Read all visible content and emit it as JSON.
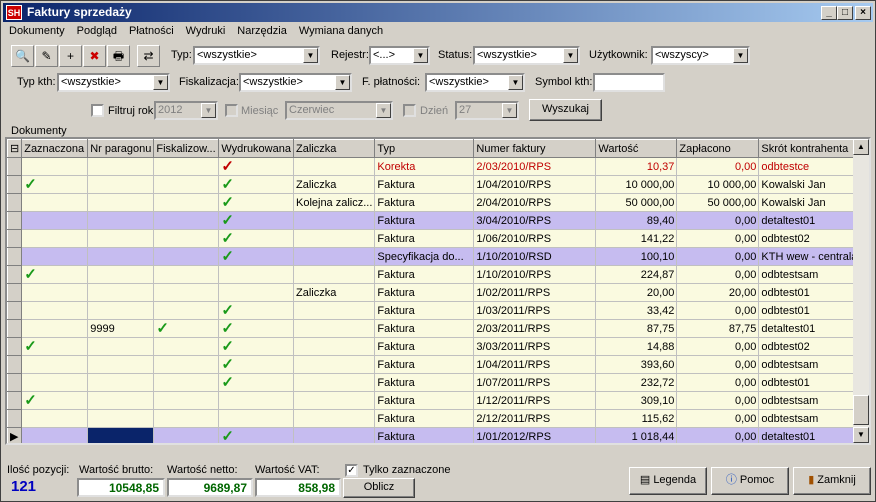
{
  "window": {
    "title": "Faktury sprzedaży",
    "app_badge": "SH"
  },
  "menu": [
    "Dokumenty",
    "Podgląd",
    "Płatności",
    "Wydruki",
    "Narzędzia",
    "Wymiana danych"
  ],
  "filters": {
    "typ_label": "Typ:",
    "typ_value": "<wszystkie>",
    "rejestr_label": "Rejestr:",
    "rejestr_value": "<...>",
    "status_label": "Status:",
    "status_value": "<wszystkie>",
    "uzytkownik_label": "Użytkownik:",
    "uzytkownik_value": "<wszyscy>",
    "typ_kth_label": "Typ kth:",
    "typ_kth_value": "<wszystkie>",
    "fiskalizacja_label": "Fiskalizacja:",
    "fiskalizacja_value": "<wszystkie>",
    "f_platnosci_label": "F. płatności:",
    "f_platnosci_value": "<wszystkie>",
    "symbol_kth_label": "Symbol kth:",
    "symbol_kth_value": "",
    "filtruj_rok_label": "Filtruj rok",
    "rok_value": "2012",
    "miesiac_label": "Miesiąc",
    "miesiac_value": "Czerwiec",
    "dzien_label": "Dzień",
    "dzien_value": "27",
    "search_button": "Wyszukaj"
  },
  "grid": {
    "group_label": "Dokumenty",
    "columns": [
      "Zaznaczona",
      "Nr paragonu",
      "Fiskalizow...",
      "Wydrukowana",
      "Zaliczka",
      "Typ",
      "Numer faktury",
      "Wartość",
      "Zapłacono",
      "Skrót kontrahenta"
    ],
    "rows": [
      {
        "style": "y red",
        "zaz": "",
        "par": "",
        "fis": "",
        "wyd": "✓",
        "zal": "",
        "typ": "Korekta",
        "nr": "2/03/2010/RPS",
        "wart": "10,37",
        "zapl": "0,00",
        "kth": "odbtestce"
      },
      {
        "style": "y",
        "zaz": "✓",
        "par": "",
        "fis": "",
        "wyd": "✓",
        "zal": "Zaliczka",
        "typ": "Faktura",
        "nr": "1/04/2010/RPS",
        "wart": "10 000,00",
        "zapl": "10 000,00",
        "kth": "Kowalski Jan"
      },
      {
        "style": "y",
        "zaz": "",
        "par": "",
        "fis": "",
        "wyd": "✓",
        "zal": "Kolejna zalicz...",
        "typ": "Faktura",
        "nr": "2/04/2010/RPS",
        "wart": "50 000,00",
        "zapl": "50 000,00",
        "kth": "Kowalski Jan"
      },
      {
        "style": "p",
        "zaz": "",
        "par": "",
        "fis": "",
        "wyd": "✓",
        "zal": "",
        "typ": "Faktura",
        "nr": "3/04/2010/RPS",
        "wart": "89,40",
        "zapl": "0,00",
        "kth": "detaltest01"
      },
      {
        "style": "y",
        "zaz": "",
        "par": "",
        "fis": "",
        "wyd": "✓",
        "zal": "",
        "typ": "Faktura",
        "nr": "1/06/2010/RPS",
        "wart": "141,22",
        "zapl": "0,00",
        "kth": "odbtest02"
      },
      {
        "style": "p",
        "zaz": "",
        "par": "",
        "fis": "",
        "wyd": "✓",
        "zal": "",
        "typ": "Specyfikacja do...",
        "nr": "1/10/2010/RSD",
        "wart": "100,10",
        "zapl": "0,00",
        "kth": "KTH wew - centrala"
      },
      {
        "style": "y",
        "zaz": "✓",
        "par": "",
        "fis": "",
        "wyd": "",
        "zal": "",
        "typ": "Faktura",
        "nr": "1/10/2010/RPS",
        "wart": "224,87",
        "zapl": "0,00",
        "kth": "odbtestsam"
      },
      {
        "style": "y",
        "zaz": "",
        "par": "",
        "fis": "",
        "wyd": "",
        "zal": "Zaliczka",
        "typ": "Faktura",
        "nr": "1/02/2011/RPS",
        "wart": "20,00",
        "zapl": "20,00",
        "kth": "odbtest01"
      },
      {
        "style": "y",
        "zaz": "",
        "par": "",
        "fis": "",
        "wyd": "✓",
        "zal": "",
        "typ": "Faktura",
        "nr": "1/03/2011/RPS",
        "wart": "33,42",
        "zapl": "0,00",
        "kth": "odbtest01"
      },
      {
        "style": "y",
        "zaz": "",
        "par": "9999",
        "fis": "✓",
        "wyd": "✓",
        "zal": "",
        "typ": "Faktura",
        "nr": "2/03/2011/RPS",
        "wart": "87,75",
        "zapl": "87,75",
        "kth": "detaltest01"
      },
      {
        "style": "y",
        "zaz": "✓",
        "par": "",
        "fis": "",
        "wyd": "✓",
        "zal": "",
        "typ": "Faktura",
        "nr": "3/03/2011/RPS",
        "wart": "14,88",
        "zapl": "0,00",
        "kth": "odbtest02"
      },
      {
        "style": "y",
        "zaz": "",
        "par": "",
        "fis": "",
        "wyd": "✓",
        "zal": "",
        "typ": "Faktura",
        "nr": "1/04/2011/RPS",
        "wart": "393,60",
        "zapl": "0,00",
        "kth": "odbtestsam"
      },
      {
        "style": "y",
        "zaz": "",
        "par": "",
        "fis": "",
        "wyd": "✓",
        "zal": "",
        "typ": "Faktura",
        "nr": "1/07/2011/RPS",
        "wart": "232,72",
        "zapl": "0,00",
        "kth": "odbtest01"
      },
      {
        "style": "y",
        "zaz": "✓",
        "par": "",
        "fis": "",
        "wyd": "",
        "zal": "",
        "typ": "Faktura",
        "nr": "1/12/2011/RPS",
        "wart": "309,10",
        "zapl": "0,00",
        "kth": "odbtestsam"
      },
      {
        "style": "y",
        "zaz": "",
        "par": "",
        "fis": "",
        "wyd": "",
        "zal": "",
        "typ": "Faktura",
        "nr": "2/12/2011/RPS",
        "wart": "115,62",
        "zapl": "0,00",
        "kth": "odbtestsam"
      },
      {
        "style": "sel",
        "zaz": "",
        "par": "",
        "fis": "",
        "wyd": "✓",
        "zal": "",
        "typ": "Faktura",
        "nr": "1/01/2012/RPS",
        "wart": "1 018,44",
        "zapl": "0,00",
        "kth": "detaltest01"
      }
    ]
  },
  "footer": {
    "ilosc_label": "Ilość pozycji:",
    "ilosc_value": "121",
    "brutto_label": "Wartość brutto:",
    "brutto_value": "10548,85",
    "netto_label": "Wartość netto:",
    "netto_value": "9689,87",
    "vat_label": "Wartość VAT:",
    "vat_value": "858,98",
    "tylko_label": "Tylko zaznaczone",
    "oblicz_button": "Oblicz",
    "legenda_button": "Legenda",
    "pomoc_button": "Pomoc",
    "zamknij_button": "Zamknij"
  }
}
